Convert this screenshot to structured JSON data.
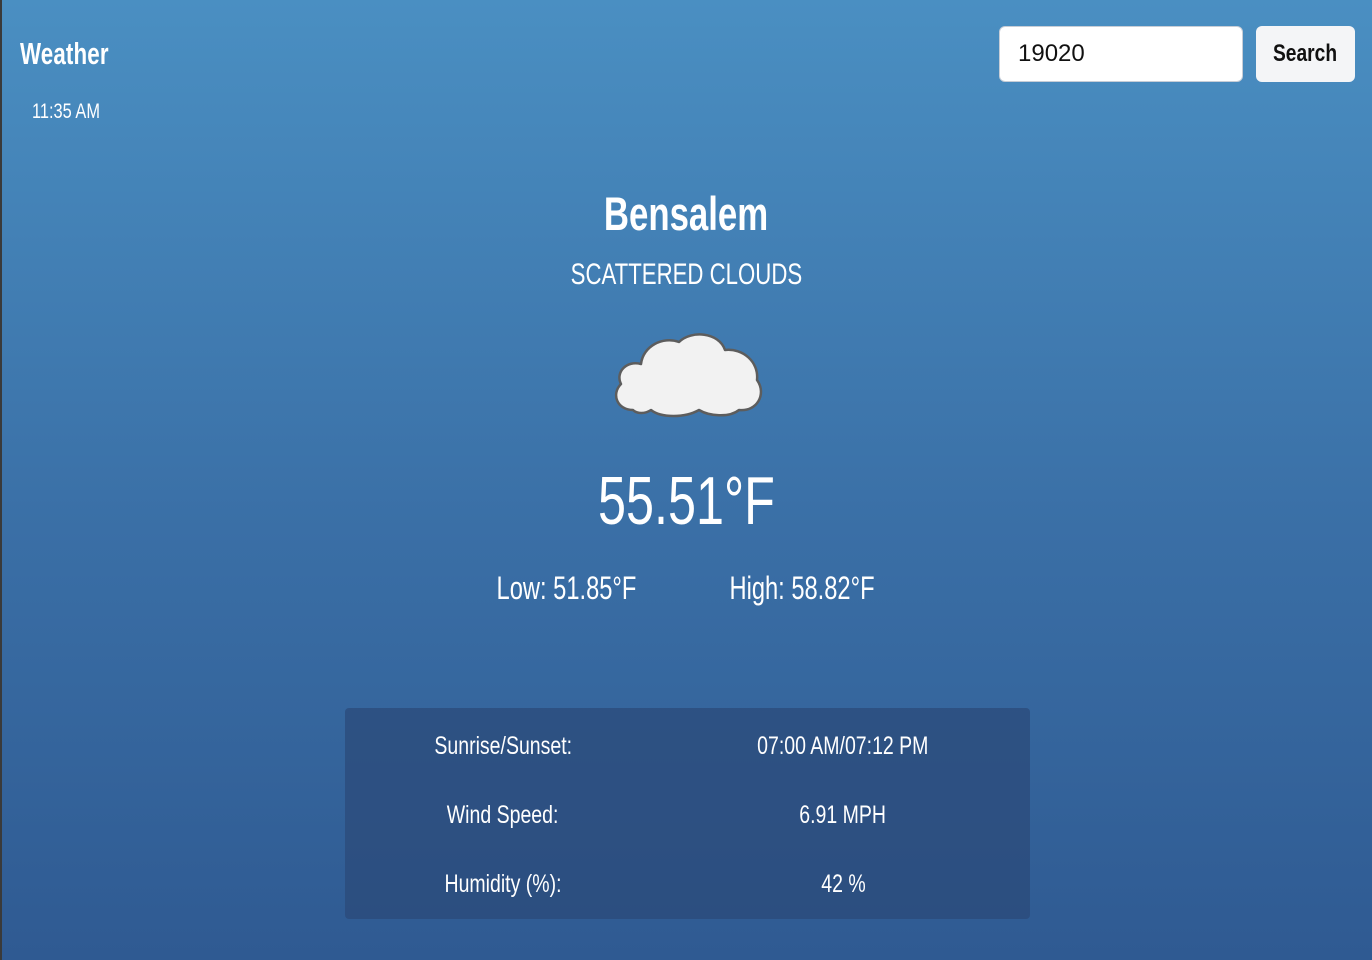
{
  "header": {
    "title": "Weather",
    "time": "11:35 AM"
  },
  "search": {
    "value": "19020",
    "button_label": "Search"
  },
  "current": {
    "city": "Bensalem",
    "condition": "SCATTERED CLOUDS",
    "icon": "cloud-icon",
    "temperature": "55.51°F",
    "low": "Low: 51.85°F",
    "high": "High: 58.82°F"
  },
  "details": [
    {
      "label": "Sunrise/Sunset:",
      "value": "07:00 AM/07:12 PM"
    },
    {
      "label": "Wind Speed:",
      "value": "6.91 MPH"
    },
    {
      "label": "Humidity (%):",
      "value": "42 %"
    }
  ],
  "colors": {
    "background_top": "#4a8fc2",
    "background_bottom": "#2f5a92",
    "panel": "#2b4a78",
    "text": "#ffffff"
  }
}
